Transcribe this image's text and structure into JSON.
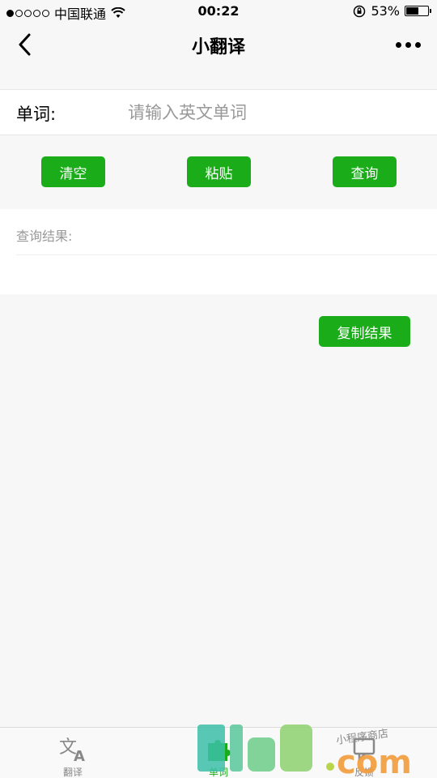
{
  "status_bar": {
    "carrier": "中国联通",
    "time": "00:22",
    "battery": "53%",
    "battery_level": 0.53
  },
  "nav": {
    "title": "小翻译"
  },
  "input": {
    "label": "单词:",
    "placeholder": "请输入英文单词",
    "value": ""
  },
  "buttons": {
    "clear": "清空",
    "paste": "粘贴",
    "query": "查询",
    "copy": "复制结果"
  },
  "result": {
    "label": "查询结果:"
  },
  "tabs": [
    {
      "label": "翻译",
      "icon": "translate-icon",
      "active": false
    },
    {
      "label": "单词",
      "icon": "puzzle-icon",
      "active": true
    },
    {
      "label": "反馈",
      "icon": "feedback-icon",
      "active": false
    }
  ],
  "watermark": {
    "brand": "51ud.com",
    "tagline": "小程序商店"
  },
  "colors": {
    "accent": "#1aad19",
    "background": "#f7f7f7"
  }
}
